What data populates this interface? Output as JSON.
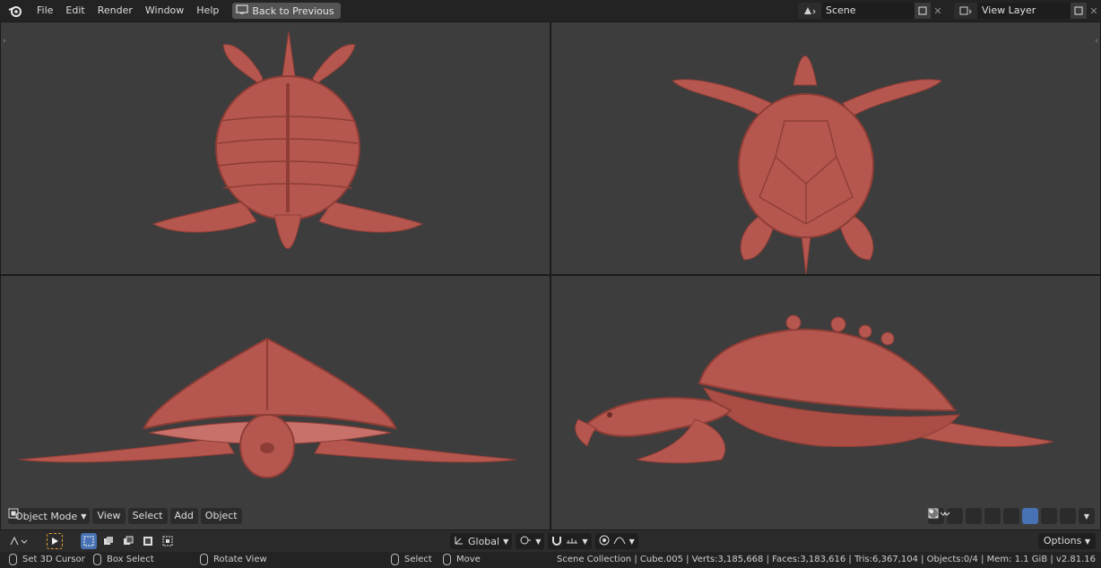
{
  "menu": {
    "items": [
      "File",
      "Edit",
      "Render",
      "Window",
      "Help"
    ],
    "back_button": "Back to Previous"
  },
  "scene": {
    "name": "Scene",
    "view_layer": "View Layer"
  },
  "viewport_header": {
    "mode": "Object Mode",
    "menus": [
      "View",
      "Select",
      "Add",
      "Object"
    ]
  },
  "toolbar": {
    "transform_orientation": "Global",
    "options_label": "Options"
  },
  "status": {
    "hints": [
      "Set 3D Cursor",
      "Box Select",
      "Rotate View",
      "Select",
      "Move"
    ],
    "stats": "Scene Collection | Cube.005 | Verts:3,185,668 | Faces:3,183,616 | Tris:6,367,104 | Objects:0/4 | Mem: 1.1 GiB | v2.81.16"
  },
  "colors": {
    "model": "#b5574f",
    "model_shade": "#8e3d36",
    "model_light": "#c8716a",
    "viewport_bg": "#3d3d3d",
    "selection_accent": "#4772b3",
    "play_accent": "#e0a030"
  }
}
